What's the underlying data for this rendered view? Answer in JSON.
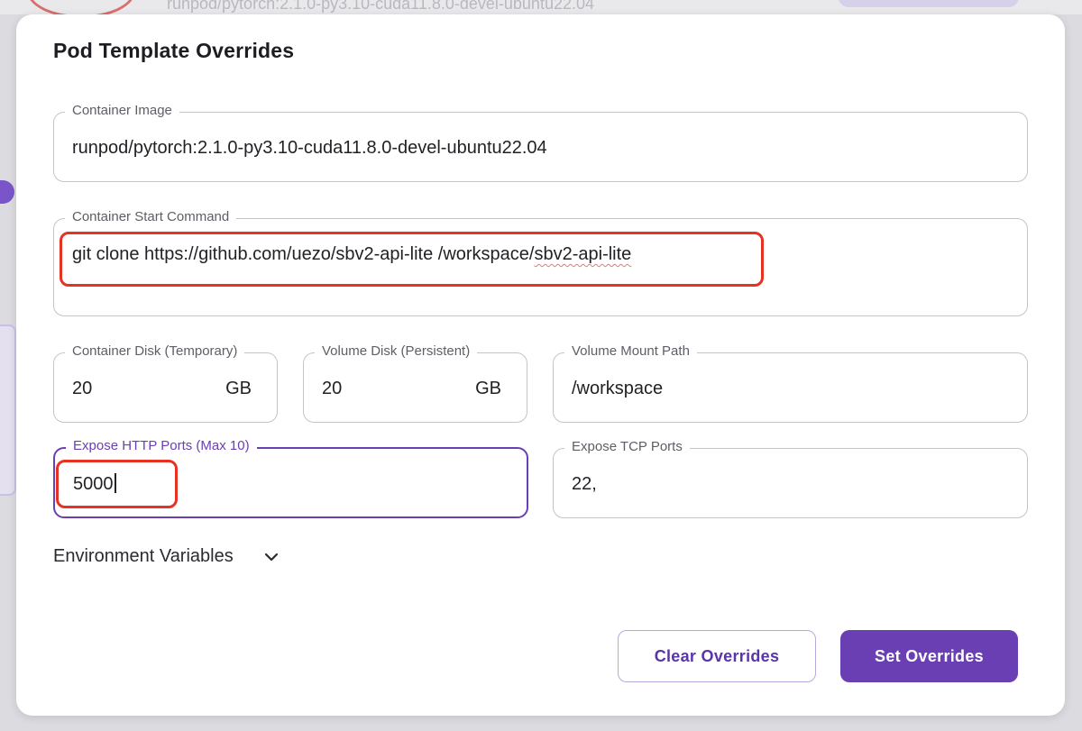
{
  "background": {
    "ghost_text": "runpod/pytorch:2.1.0-py3.10-cuda11.8.0-devel-ubuntu22.04"
  },
  "modal": {
    "title": "Pod Template Overrides",
    "fields": {
      "container_image": {
        "label": "Container Image",
        "value": "runpod/pytorch:2.1.0-py3.10-cuda11.8.0-devel-ubuntu22.04"
      },
      "start_command": {
        "label": "Container Start Command",
        "value_prefix": "git clone https://github.com/uezo/sbv2-api-lite /workspace/",
        "value_misspelled": "sbv2-api-lite"
      },
      "container_disk": {
        "label": "Container Disk (Temporary)",
        "value": "20",
        "unit": "GB"
      },
      "volume_disk": {
        "label": "Volume Disk (Persistent)",
        "value": "20",
        "unit": "GB"
      },
      "volume_mount_path": {
        "label": "Volume Mount Path",
        "value": "/workspace"
      },
      "http_ports": {
        "label": "Expose HTTP Ports (Max 10)",
        "value": "5000"
      },
      "tcp_ports": {
        "label": "Expose TCP Ports",
        "value": "22,"
      }
    },
    "env_toggle": {
      "label": "Environment Variables",
      "icon": "chevron-down-icon"
    },
    "buttons": {
      "clear": "Clear Overrides",
      "set": "Set Overrides"
    }
  },
  "colors": {
    "accent": "#6a3fb3",
    "annotation": "#e53222",
    "text": "#222226",
    "label": "#5e5e66"
  }
}
